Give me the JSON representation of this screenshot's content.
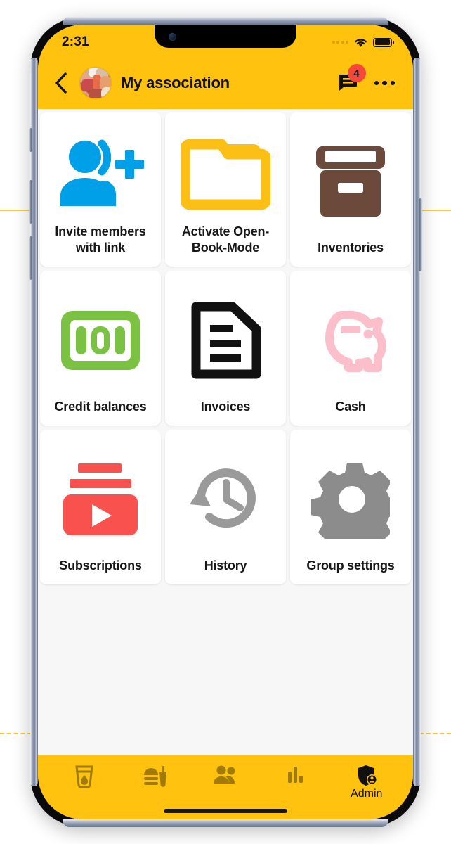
{
  "status_bar": {
    "time": "2:31",
    "signal_icon": "signal-dots-icon",
    "wifi_icon": "wifi-icon",
    "battery_icon": "battery-full-icon"
  },
  "header": {
    "back_icon": "back-chevron-icon",
    "avatar_icon": "group-avatar-image",
    "title": "My association",
    "chat_icon": "chat-bubble-icon",
    "chat_badge": "4",
    "menu_icon": "kebab-menu-icon"
  },
  "colors": {
    "brand_yellow": "#FFC20E",
    "badge_red": "#F5483B",
    "invite_blue": "#00A0E9",
    "folder_yellow": "#FBBF16",
    "inventory_brown": "#6B4A3C",
    "credit_green": "#7CC242",
    "cash_pink": "#FBBECB",
    "subscriptions_red": "#F9514D",
    "history_gray": "#9A9A9A",
    "settings_gray": "#8C8C8C",
    "tile_bg": "#FFFFFF",
    "screen_bg": "#F7F7F7"
  },
  "tiles": [
    {
      "label": "Invite members with link",
      "icon": "person-add-icon"
    },
    {
      "label": "Activate Open-Book-Mode",
      "icon": "open-folder-icon"
    },
    {
      "label": "Inventories",
      "icon": "archive-box-icon"
    },
    {
      "label": "Credit balances",
      "icon": "banknote-100-icon"
    },
    {
      "label": "Invoices",
      "icon": "document-lines-icon"
    },
    {
      "label": "Cash",
      "icon": "piggy-bank-icon"
    },
    {
      "label": "Subscriptions",
      "icon": "video-play-stack-icon"
    },
    {
      "label": "History",
      "icon": "clock-rewind-icon"
    },
    {
      "label": "Group settings",
      "icon": "gear-icon"
    }
  ],
  "bottom_nav": [
    {
      "label": "",
      "icon": "drink-glass-icon",
      "active": false
    },
    {
      "label": "",
      "icon": "fast-food-icon",
      "active": false
    },
    {
      "label": "",
      "icon": "people-icon",
      "active": false
    },
    {
      "label": "",
      "icon": "bar-chart-icon",
      "active": false
    },
    {
      "label": "Admin",
      "icon": "shield-person-icon",
      "active": true
    }
  ]
}
